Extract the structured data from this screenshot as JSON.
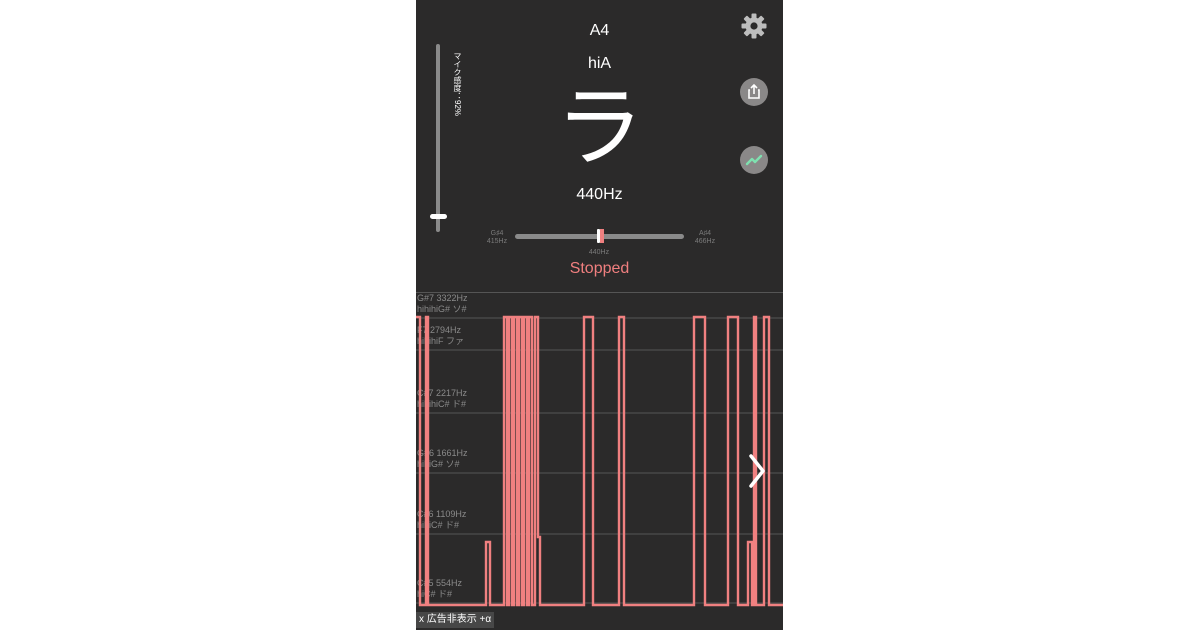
{
  "tuner": {
    "note_name": "A4",
    "octave_label": "hiA",
    "solfege": "ラ",
    "frequency": "440Hz",
    "status": "Stopped",
    "mic_sensitivity_label": "マイク感度：92%",
    "mic_sensitivity_value": 0.92,
    "deviation_cents": 0,
    "lower_note": {
      "name": "G♯4",
      "freq": "415Hz"
    },
    "upper_note": {
      "name": "A♯4",
      "freq": "466Hz"
    },
    "center_freq": "440Hz"
  },
  "icons": {
    "settings": "gear-icon",
    "share": "share-icon",
    "trend": "trend-line-icon",
    "next": "chevron-right-icon"
  },
  "colors": {
    "background": "#2b2a2a",
    "accent": "#f07f7f",
    "text": "#ffffff",
    "trend_icon": "#7fe0b0"
  },
  "graph": {
    "gridlines": [
      {
        "line1": "G#7 3322Hz",
        "line2": "hihihiG# ソ#"
      },
      {
        "line1": "F7 2794Hz",
        "line2": "hihihiF ファ"
      },
      {
        "line1": "C#7 2217Hz",
        "line2": "hihihiC# ド#"
      },
      {
        "line1": "G#6 1661Hz",
        "line2": "hihiG# ソ#"
      },
      {
        "line1": "C#6 1109Hz",
        "line2": "hihiC# ド#"
      },
      {
        "line1": "C#5 554Hz",
        "line2": "hiC# ド#"
      }
    ]
  },
  "ad": {
    "label": "x 広告非表示 +α"
  }
}
